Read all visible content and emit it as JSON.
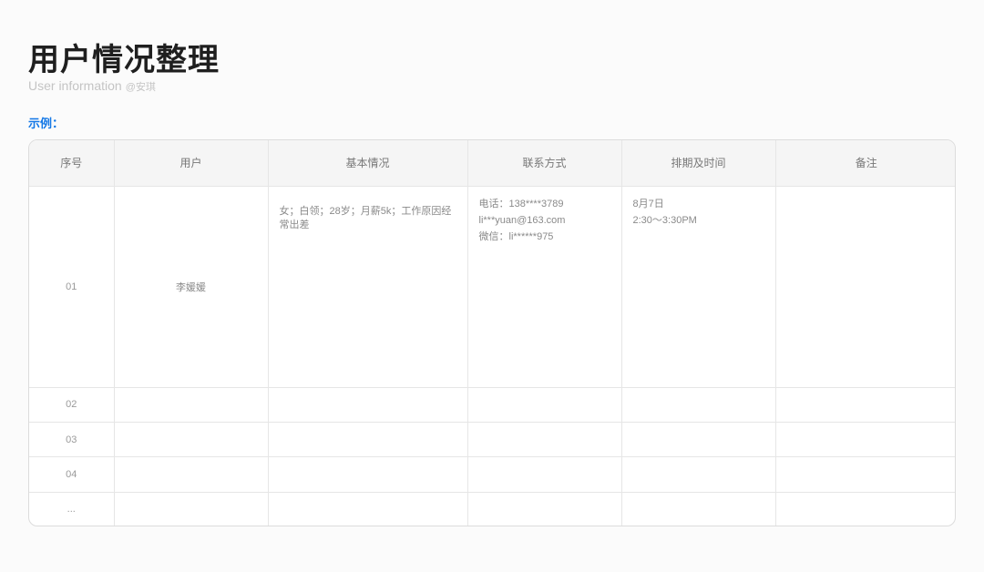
{
  "header": {
    "title": "用户情况整理",
    "subtitle": "User information",
    "author": "@安琪",
    "example_label": "示例："
  },
  "table": {
    "columns": [
      "序号",
      "用户",
      "基本情况",
      "联系方式",
      "排期及时间",
      "备注"
    ],
    "rows": [
      {
        "index": "01",
        "user": "李媛媛",
        "basic": "女；白领；28岁；月薪5k；工作原因经常出差",
        "contact": [
          "电话：138****3789",
          "li***yuan@163.com",
          "微信：li******975"
        ],
        "schedule": [
          "8月7日",
          "2:30～3:30PM"
        ],
        "note": ""
      },
      {
        "index": "02"
      },
      {
        "index": "03"
      },
      {
        "index": "04"
      },
      {
        "index": "..."
      }
    ]
  }
}
